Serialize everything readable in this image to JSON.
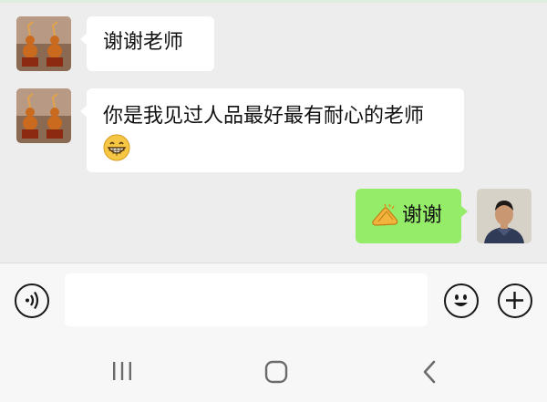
{
  "messages": [
    {
      "side": "left",
      "text": "谢谢老师",
      "avatar": "gourd-figurines-avatar"
    },
    {
      "side": "left",
      "text": "你是我见过人品最好最有耐心的老师",
      "emoji": "grinning-face-emoji",
      "avatar": "gourd-figurines-avatar"
    },
    {
      "side": "right",
      "text": "谢谢",
      "emoji": "clapping-hands-emoji",
      "avatar": "man-portrait-avatar"
    }
  ],
  "input": {
    "value": "",
    "placeholder": ""
  },
  "icons": {
    "voice": "voice-input-icon",
    "emoji": "emoji-icon",
    "plus": "plus-icon",
    "nav_recent": "recent-apps-icon",
    "nav_home": "home-icon",
    "nav_back": "back-icon"
  },
  "colors": {
    "chat_background": "#ededed",
    "incoming_bubble": "#ffffff",
    "outgoing_bubble": "#95ec69",
    "input_bar": "#f7f7f7"
  }
}
